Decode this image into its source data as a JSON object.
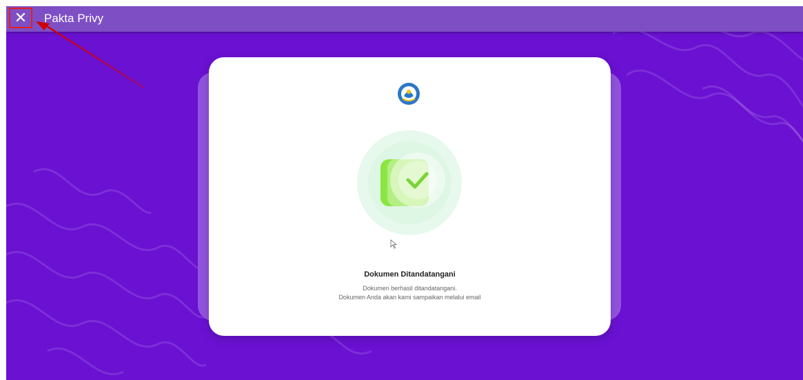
{
  "header": {
    "title": "Pakta Privy",
    "close_glyph": "✕"
  },
  "card": {
    "title": "Dokumen Ditandatangani",
    "message_line1": "Dokumen berhasil ditandatangani.",
    "message_line2": "Dokumen Anda akan kami sampaikan melalui email"
  },
  "icons": {
    "logo": "tut-wuri-handayani-logo",
    "success": "document-check-icon",
    "close": "close-icon"
  },
  "colors": {
    "background": "#6a11d2",
    "topbar": "#7e4fc4",
    "card": "#ffffff",
    "card_back": "#9253df",
    "success_green": "#8ae640",
    "annotation_red": "#e02020"
  }
}
